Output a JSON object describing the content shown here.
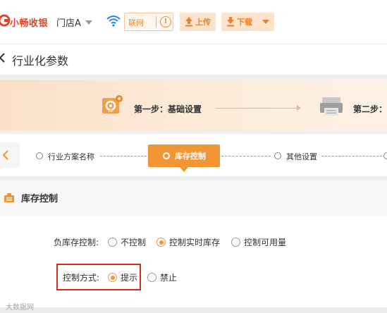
{
  "header": {
    "app_name": "小畅收银",
    "store_name": "门店A",
    "network_button": "联网",
    "upload_button": "上传",
    "download_button": "下载"
  },
  "page": {
    "title": "行业化参数"
  },
  "steps": [
    {
      "label": "第一步：基础设置"
    },
    {
      "label": "第二步："
    }
  ],
  "tabs": [
    {
      "label": "行业方案名称",
      "active": false
    },
    {
      "label": "库存控制",
      "active": true
    },
    {
      "label": "其他设置",
      "active": false
    }
  ],
  "section": {
    "title": "库存控制"
  },
  "form": {
    "negative_stock": {
      "label": "负库存控制:",
      "options": [
        "不控制",
        "控制实时库存",
        "控制可用量"
      ],
      "selected": "控制实时库存"
    },
    "control_mode": {
      "label": "控制方式:",
      "options": [
        "提示",
        "禁止"
      ],
      "selected": "提示"
    }
  },
  "watermark": "大数据网",
  "colors": {
    "accent": "#f29535",
    "brand_red": "#e0442f",
    "highlight_box": "#d9291c",
    "wifi": "#1e88e5"
  },
  "icons": {
    "logo": "logo-icon",
    "wifi": "wifi-icon",
    "network_alert": "alert-icon",
    "upload": "upload-icon",
    "download": "download-icon",
    "back": "chevron-left-icon",
    "step1": "settings-gear-icon",
    "step2": "printer-icon",
    "section": "inventory-icon"
  }
}
